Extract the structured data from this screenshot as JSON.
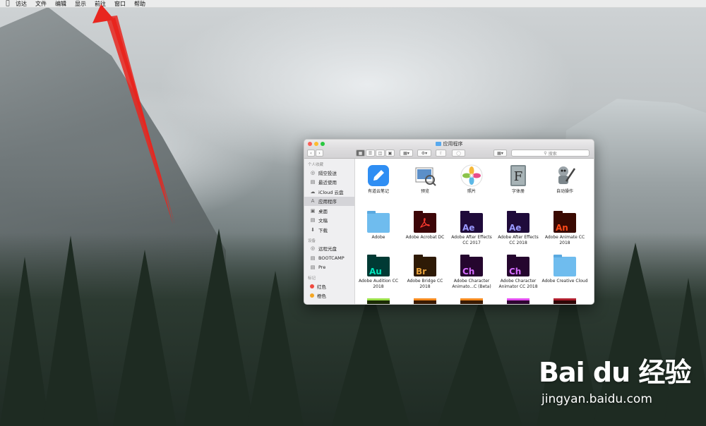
{
  "menubar": {
    "items": [
      "访达",
      "文件",
      "编辑",
      "显示",
      "前往",
      "窗口",
      "帮助"
    ]
  },
  "window": {
    "title": "应用程序",
    "search_placeholder": "搜索"
  },
  "sidebar": {
    "sections": {
      "favorites": "个人收藏",
      "devices": "设备",
      "tags": "标记"
    },
    "favorites": [
      "隔空投送",
      "最近使用",
      "iCloud 云盘",
      "应用程序",
      "桌面",
      "文稿",
      "下载"
    ],
    "devices": [
      "远程光盘",
      "BOOTCAMP",
      "Pre"
    ],
    "tags": [
      "红色",
      "橙色"
    ]
  },
  "apps": [
    {
      "label": "有道云笔记",
      "icon": "youdao-note-icon"
    },
    {
      "label": "预览",
      "icon": "preview-icon"
    },
    {
      "label": "照片",
      "icon": "photos-icon"
    },
    {
      "label": "字体册",
      "icon": "font-book-icon"
    },
    {
      "label": "自动操作",
      "icon": "automator-icon"
    },
    {
      "label": "Adobe",
      "icon": "folder-icon"
    },
    {
      "label": "Adobe Acrobat DC",
      "icon": "acrobat-folder-icon",
      "abbr": ""
    },
    {
      "label": "Adobe After Effects CC 2017",
      "icon": "after-effects-folder-icon",
      "abbr": "Ae"
    },
    {
      "label": "Adobe After Effects CC 2018",
      "icon": "after-effects-folder-icon",
      "abbr": "Ae"
    },
    {
      "label": "Adobe Animate CC 2018",
      "icon": "animate-folder-icon",
      "abbr": "An"
    },
    {
      "label": "Adobe Audition CC 2018",
      "icon": "audition-folder-icon",
      "abbr": "Au"
    },
    {
      "label": "Adobe Bridge CC 2018",
      "icon": "bridge-folder-icon",
      "abbr": "Br"
    },
    {
      "label": "Adobe Character Animato...C (Beta)",
      "icon": "character-animator-folder-icon",
      "abbr": "Ch"
    },
    {
      "label": "Adobe Character Animator CC 2018",
      "icon": "character-animator-folder-icon",
      "abbr": "Ch"
    },
    {
      "label": "Adobe Creative Cloud",
      "icon": "folder-icon"
    }
  ],
  "watermark": {
    "logo": "Bai du 经验",
    "url": "jingyan.baidu.com"
  },
  "colors": {
    "arrow": "#e8261f",
    "close": "#fc5f57",
    "minimize": "#fdbc2e",
    "maximize": "#29c840",
    "folder": "#6fbcee",
    "ae": "#9999ff",
    "an": "#ff4a19",
    "au": "#00e4bb",
    "br": "#e8a23d",
    "ch": "#d56cff",
    "tag_red": "#f04a3f",
    "tag_orange": "#f5a623"
  }
}
